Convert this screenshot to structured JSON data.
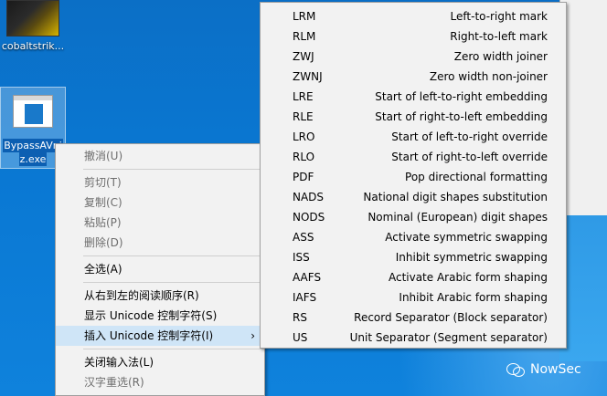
{
  "desktop": {
    "icons": [
      {
        "label": "cobaltstrik..."
      },
      {
        "label_line1": "BypassAVni",
        "label_line2": "z.exe"
      }
    ]
  },
  "context_menu": {
    "items": [
      {
        "label": "撤消(U)",
        "enabled": false
      },
      {
        "label": "剪切(T)",
        "enabled": false
      },
      {
        "label": "复制(C)",
        "enabled": false
      },
      {
        "label": "粘贴(P)",
        "enabled": false
      },
      {
        "label": "删除(D)",
        "enabled": false
      },
      {
        "label": "全选(A)",
        "enabled": true
      },
      {
        "label": "从右到左的阅读顺序(R)",
        "enabled": true
      },
      {
        "label": "显示 Unicode 控制字符(S)",
        "enabled": true
      },
      {
        "label": "插入 Unicode 控制字符(I)",
        "enabled": true,
        "arrow": "›"
      },
      {
        "label": "关闭输入法(L)",
        "enabled": true
      },
      {
        "label": "汉字重选(R)",
        "enabled": false
      }
    ]
  },
  "submenu": {
    "items": [
      {
        "code": "LRM",
        "desc": "Left-to-right mark"
      },
      {
        "code": "RLM",
        "desc": "Right-to-left mark"
      },
      {
        "code": "ZWJ",
        "desc": "Zero width joiner"
      },
      {
        "code": "ZWNJ",
        "desc": "Zero width non-joiner"
      },
      {
        "code": "LRE",
        "desc": "Start of left-to-right embedding"
      },
      {
        "code": "RLE",
        "desc": "Start of right-to-left embedding"
      },
      {
        "code": "LRO",
        "desc": "Start of left-to-right override"
      },
      {
        "code": "RLO",
        "desc": "Start of right-to-left override"
      },
      {
        "code": "PDF",
        "desc": "Pop directional formatting"
      },
      {
        "code": "NADS",
        "desc": "National digit shapes substitution"
      },
      {
        "code": "NODS",
        "desc": "Nominal (European) digit shapes"
      },
      {
        "code": "ASS",
        "desc": "Activate symmetric swapping"
      },
      {
        "code": "ISS",
        "desc": "Inhibit symmetric swapping"
      },
      {
        "code": "AAFS",
        "desc": "Activate Arabic form shaping"
      },
      {
        "code": "IAFS",
        "desc": "Inhibit Arabic form shaping"
      },
      {
        "code": "RS",
        "desc": "Record Separator (Block separator)"
      },
      {
        "code": "US",
        "desc": "Unit Separator (Segment separator)"
      }
    ]
  },
  "watermark": {
    "text": "NowSec",
    "icon": "wechat-icon"
  }
}
